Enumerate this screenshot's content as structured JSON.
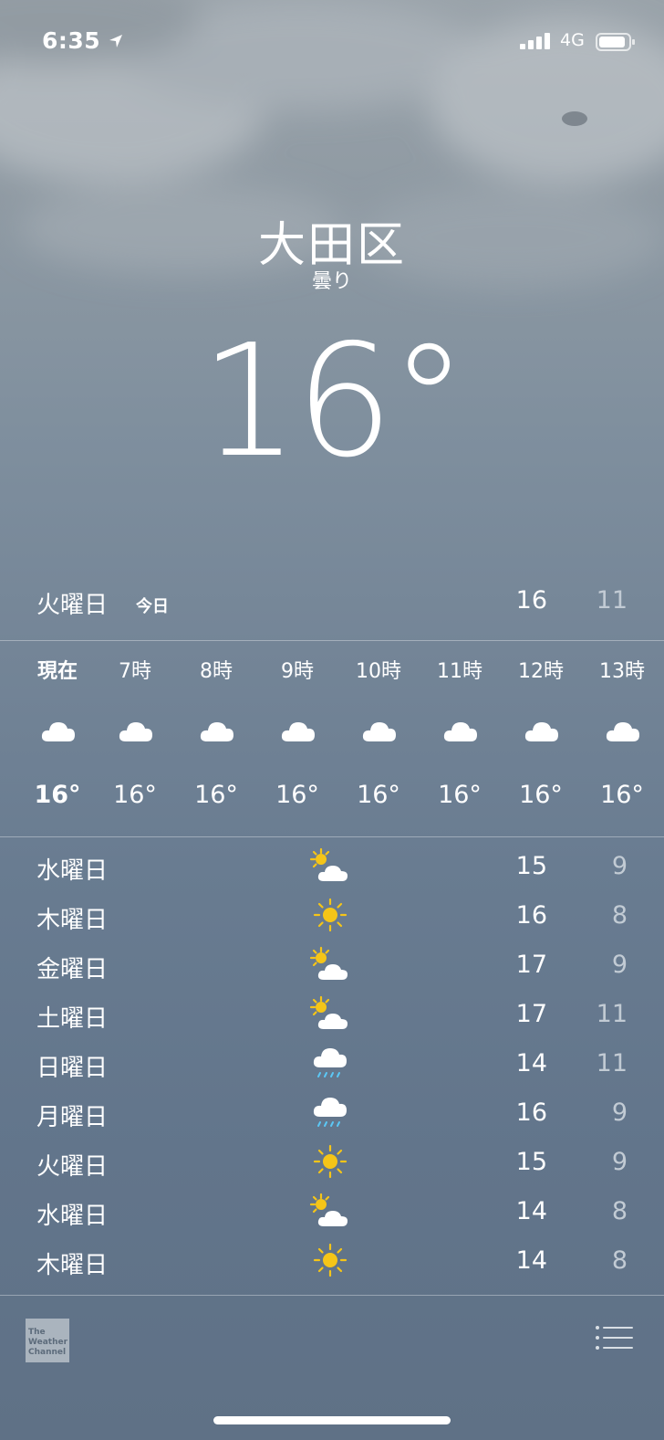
{
  "status_bar": {
    "time": "6:35",
    "network": "4G",
    "location_icon": "location-arrow-icon",
    "signal_icon": "signal-icon",
    "battery_icon": "battery-icon"
  },
  "header": {
    "city": "大田区",
    "condition": "曇り",
    "temperature": "16°"
  },
  "today": {
    "day": "火曜日",
    "tag": "今日",
    "high": "16",
    "low": "11"
  },
  "hourly": [
    {
      "label": "現在",
      "icon": "cloud-icon",
      "temp": "16°",
      "current": true
    },
    {
      "label": "7時",
      "icon": "cloud-icon",
      "temp": "16°"
    },
    {
      "label": "8時",
      "icon": "cloud-icon",
      "temp": "16°"
    },
    {
      "label": "9時",
      "icon": "cloud-icon",
      "temp": "16°"
    },
    {
      "label": "10時",
      "icon": "cloud-icon",
      "temp": "16°"
    },
    {
      "label": "11時",
      "icon": "cloud-icon",
      "temp": "16°"
    },
    {
      "label": "12時",
      "icon": "cloud-icon",
      "temp": "16°"
    },
    {
      "label": "13時",
      "icon": "cloud-icon",
      "temp": "16°"
    }
  ],
  "daily": [
    {
      "day": "水曜日",
      "icon": "partly-cloudy-icon",
      "high": "15",
      "low": "9"
    },
    {
      "day": "木曜日",
      "icon": "sun-icon",
      "high": "16",
      "low": "8"
    },
    {
      "day": "金曜日",
      "icon": "partly-cloudy-icon",
      "high": "17",
      "low": "9"
    },
    {
      "day": "土曜日",
      "icon": "partly-cloudy-icon",
      "high": "17",
      "low": "11"
    },
    {
      "day": "日曜日",
      "icon": "rain-icon",
      "high": "14",
      "low": "11"
    },
    {
      "day": "月曜日",
      "icon": "rain-icon",
      "high": "16",
      "low": "9"
    },
    {
      "day": "火曜日",
      "icon": "sun-icon",
      "high": "15",
      "low": "9"
    },
    {
      "day": "水曜日",
      "icon": "partly-cloudy-icon",
      "high": "14",
      "low": "8"
    },
    {
      "day": "木曜日",
      "icon": "sun-icon",
      "high": "14",
      "low": "8"
    }
  ],
  "footer": {
    "logo_text": "The Weather Channel",
    "list_icon": "list-icon"
  },
  "colors": {
    "sun": "#f5c518",
    "rain": "#5bc8f5",
    "low_temp": "#c2cbd4"
  }
}
